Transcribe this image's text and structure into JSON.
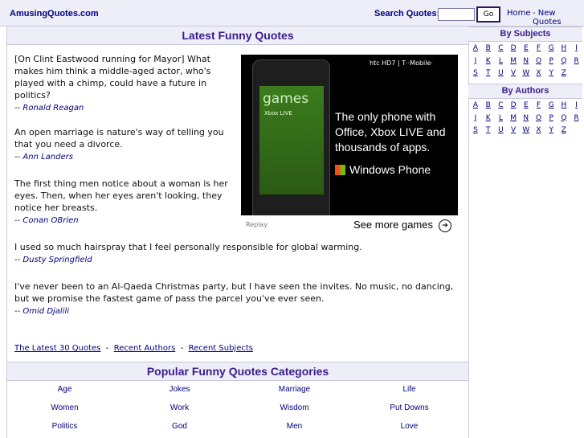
{
  "header": {
    "logo": "AmusingQuotes.com",
    "search_label": "Search Quotes:",
    "search_value": "",
    "go_label": "Go",
    "home_link": "Home",
    "new_quotes_link": "- New Quotes"
  },
  "main": {
    "title": "Latest Funny Quotes",
    "quotes": [
      {
        "text": "[On Clint Eastwood running for Mayor] What makes him think a middle-aged actor, who's played with a chimp, could have a future in politics?",
        "author": "Ronald Reagan"
      },
      {
        "text": "An open marriage is nature's way of telling you that you need a divorce.",
        "author": "Ann Landers"
      },
      {
        "text": "The first thing men notice about a woman is her eyes. Then, when her eyes aren't looking, they notice her breasts.",
        "author": "Conan OBrien"
      },
      {
        "text": "I used so much hairspray that I feel personally responsible for global warming.",
        "author": "Dusty Springfield"
      },
      {
        "text": "I've never been to an Al-Qaeda Christmas party, but I have seen the invites. No music, no dancing, but we promise the fastest game of pass the parcel you've ever seen.",
        "author": "Omid Djalili"
      }
    ],
    "dash": "--",
    "bottom_links": [
      "The Latest 30 Quotes",
      "Recent Authors",
      "Recent Subjects"
    ],
    "separator": "-",
    "categories_title": "Popular Funny Quotes Categories",
    "categories": [
      [
        "Age",
        "Jokes",
        "Marriage",
        "Life"
      ],
      [
        "Women",
        "Work",
        "Wisdom",
        "Put Downs"
      ],
      [
        "Politics",
        "God",
        "Men",
        "Love"
      ]
    ]
  },
  "ad": {
    "brand": "htc HD7 | T··Mobile·",
    "screen_title": "games",
    "screen_sub": "Xbox LIVE",
    "headline": "The only phone with Office, Xbox LIVE and thousands of apps.",
    "product": "Windows Phone",
    "replay": "Replay",
    "cta": "See more games",
    "arrow": "➔"
  },
  "sidebar": {
    "subjects_title": "By Subjects",
    "authors_title": "By Authors",
    "letters": [
      [
        "A",
        "B",
        "C",
        "D",
        "E",
        "F",
        "G",
        "H",
        "I"
      ],
      [
        "J",
        "K",
        "L",
        "M",
        "N",
        "O",
        "P",
        "Q",
        "R"
      ],
      [
        "S",
        "T",
        "U",
        "V",
        "W",
        "X",
        "Y",
        "Z"
      ]
    ]
  }
}
